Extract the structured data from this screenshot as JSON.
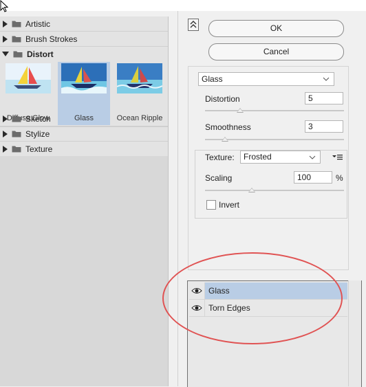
{
  "categories": [
    {
      "label": "Artistic",
      "expanded": false
    },
    {
      "label": "Brush Strokes",
      "expanded": false
    },
    {
      "label": "Distort",
      "expanded": true
    },
    {
      "label": "Sketch",
      "expanded": false
    },
    {
      "label": "Stylize",
      "expanded": false
    },
    {
      "label": "Texture",
      "expanded": false
    }
  ],
  "distort_filters": [
    {
      "label": "Diffuse Glow",
      "selected": false
    },
    {
      "label": "Glass",
      "selected": true
    },
    {
      "label": "Ocean Ripple",
      "selected": false
    }
  ],
  "buttons": {
    "ok": "OK",
    "cancel": "Cancel"
  },
  "filter_select": {
    "value": "Glass"
  },
  "distortion": {
    "label": "Distortion",
    "value": "5"
  },
  "smoothness": {
    "label": "Smoothness",
    "value": "3"
  },
  "texture": {
    "label": "Texture:",
    "value": "Frosted"
  },
  "scaling": {
    "label": "Scaling",
    "value": "100",
    "unit": "%"
  },
  "invert": {
    "label": "Invert",
    "checked": false
  },
  "layers": [
    {
      "name": "Glass",
      "selected": true,
      "visible": true
    },
    {
      "name": "Torn Edges",
      "selected": false,
      "visible": true
    }
  ],
  "colors": {
    "selection": "#b9cde5",
    "annotation": "#e05353"
  },
  "icons": {
    "cursor": "arrow-cursor-icon",
    "collapse": "collapse-up-icon",
    "eye": "eye-icon",
    "folder": "folder-icon",
    "menu": "panel-menu-icon"
  }
}
